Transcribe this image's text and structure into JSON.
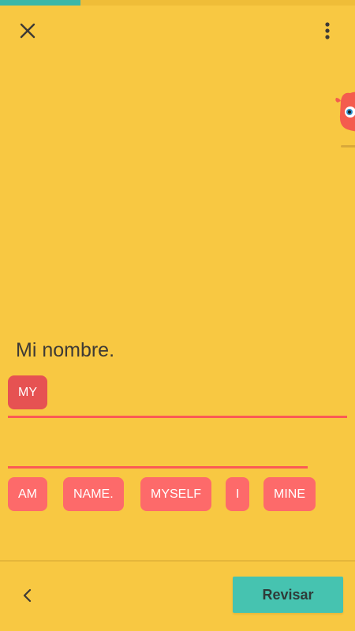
{
  "progress": {
    "fraction": 0.227
  },
  "header": {
    "close_icon": "close-icon",
    "more_icon": "more-vert-icon"
  },
  "exercise": {
    "prompt": "Mi nombre.",
    "answer_chips": [
      "MY"
    ],
    "word_bank": [
      "AM",
      "NAME.",
      "MYSELF",
      "I",
      "MINE"
    ]
  },
  "footer": {
    "back_icon": "chevron-left-icon",
    "check_label": "Revisar"
  },
  "colors": {
    "background": "#f8c842",
    "progress_fill": "#3cb7a8",
    "chip": "#fd6a6a",
    "chip_selected": "#e65252",
    "line": "#fb5a55",
    "check_button": "#46c3b0"
  }
}
